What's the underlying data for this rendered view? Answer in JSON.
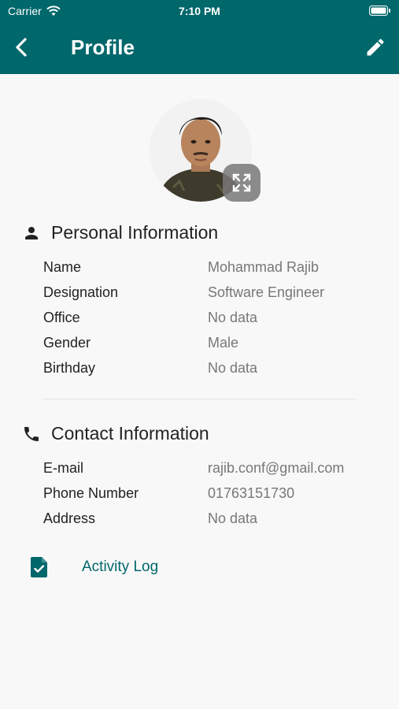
{
  "status_bar": {
    "carrier": "Carrier",
    "time": "7:10 PM"
  },
  "header": {
    "title": "Profile"
  },
  "personal": {
    "heading": "Personal Information",
    "rows": [
      {
        "label": "Name",
        "value": "Mohammad Rajib"
      },
      {
        "label": "Designation",
        "value": "Software Engineer"
      },
      {
        "label": "Office",
        "value": "No data"
      },
      {
        "label": "Gender",
        "value": "Male"
      },
      {
        "label": "Birthday",
        "value": "No data"
      }
    ]
  },
  "contact": {
    "heading": "Contact Information",
    "rows": [
      {
        "label": "E-mail",
        "value": "rajib.conf@gmail.com"
      },
      {
        "label": "Phone Number",
        "value": "01763151730"
      },
      {
        "label": "Address",
        "value": "No data"
      }
    ]
  },
  "activity_log": {
    "label": "Activity Log"
  },
  "colors": {
    "primary": "#00676b",
    "background": "#f8f8f8"
  },
  "icons": [
    "back-arrow-icon",
    "pencil-icon",
    "expand-icon",
    "person-icon",
    "phone-icon",
    "document-check-icon"
  ]
}
